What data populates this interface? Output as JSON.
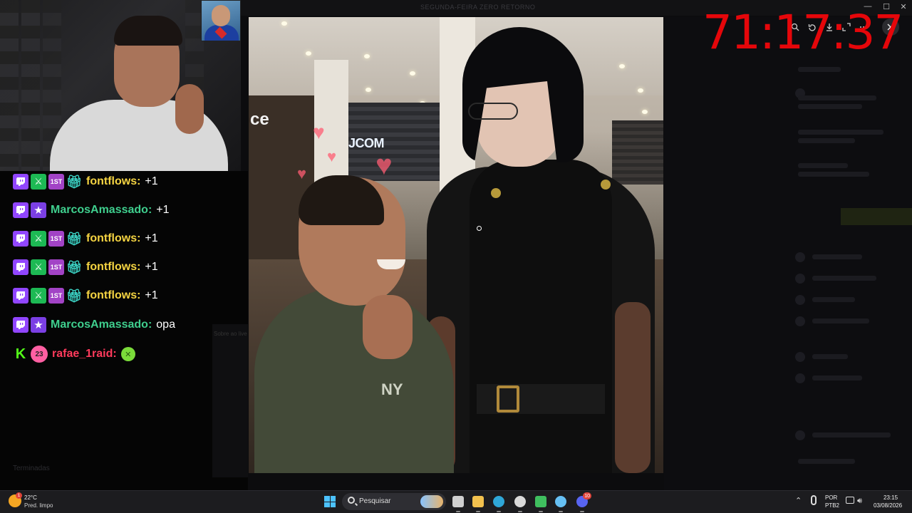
{
  "background_app": {
    "title": "SEGUNDA-FEIRA ZERO RETORNO",
    "minimize": "—",
    "maximize": "☐",
    "close": "✕",
    "ghost_text": "Sobre ao live",
    "bottom_label": "Terminadas"
  },
  "timer": "71:17:37",
  "chat": [
    {
      "badges": [
        "twitch",
        "sword",
        "first",
        "gift"
      ],
      "user": "fontflows",
      "user_color": "#f5d442",
      "message": "+1"
    },
    {
      "badges": [
        "twitch",
        "star"
      ],
      "user": "MarcosAmassado",
      "user_color": "#3fcf8e",
      "message": "+1"
    },
    {
      "badges": [
        "twitch",
        "sword",
        "first",
        "gift"
      ],
      "user": "fontflows",
      "user_color": "#f5d442",
      "message": "+1"
    },
    {
      "badges": [
        "twitch",
        "sword",
        "first",
        "gift"
      ],
      "user": "fontflows",
      "user_color": "#f5d442",
      "message": "+1"
    },
    {
      "badges": [
        "twitch",
        "sword",
        "first",
        "gift"
      ],
      "user": "fontflows",
      "user_color": "#f5d442",
      "message": "+1"
    },
    {
      "badges": [
        "twitch",
        "star"
      ],
      "user": "MarcosAmassado",
      "user_color": "#3fcf8e",
      "message": "opa"
    },
    {
      "badges": [
        "kick",
        "sub"
      ],
      "sub_count": "23",
      "user": "rafae_1raid",
      "user_color": "#ff3b5c",
      "message": "",
      "emote": "nauseated-face-emote"
    }
  ],
  "photo": {
    "store_sign_left": "ce",
    "store_sign_mid": "JCOM",
    "shirt_logo": "NY"
  },
  "viewer_toolbar": {
    "zoom_icon": "zoom-in-icon",
    "rotate_icon": "rotate-icon",
    "download_icon": "download-icon",
    "expand_icon": "expand-icon",
    "more_icon": "more-icon",
    "close_icon": "close-icon"
  },
  "taskbar": {
    "weather_temp": "22°C",
    "weather_desc": "Pred. limpo",
    "weather_badge": "1",
    "search_placeholder": "Pesquisar",
    "apps": [
      {
        "name": "task-view",
        "color": "#cfcfcf"
      },
      {
        "name": "file-explorer",
        "color": "#f2c14e"
      },
      {
        "name": "edge",
        "color": "#2fa7d8"
      },
      {
        "name": "obs",
        "color": "#d9d9d9"
      },
      {
        "name": "app-green",
        "color": "#3fbf5f"
      },
      {
        "name": "steam",
        "color": "#66c0f4"
      },
      {
        "name": "discord",
        "color": "#5865f2",
        "badge": "10"
      }
    ],
    "language_top": "POR",
    "language_bottom": "PTB2",
    "time": "23:15",
    "date": "03/08/2026"
  }
}
